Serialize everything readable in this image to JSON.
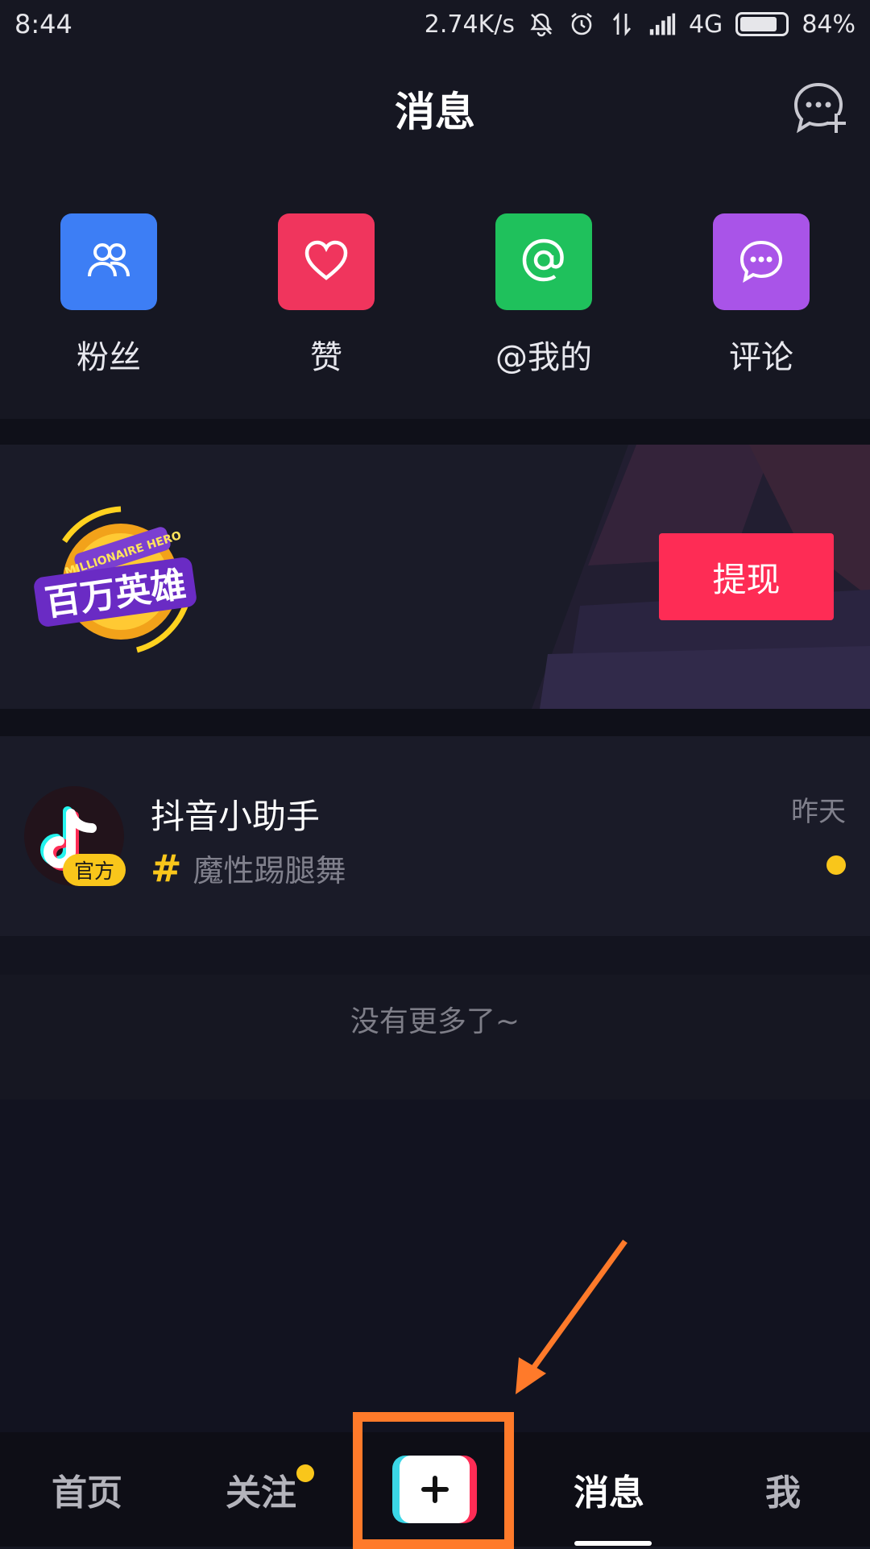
{
  "status_bar": {
    "time": "8:44",
    "network_speed": "2.74K/s",
    "network_type": "4G",
    "battery_percent": "84%",
    "battery_level": 0.84,
    "icons": [
      "mute-icon",
      "alarm-icon",
      "data-transfer-icon",
      "signal-icon",
      "battery-icon"
    ]
  },
  "header": {
    "title": "消息",
    "action_icon": "new-chat-icon"
  },
  "quick_actions": [
    {
      "label": "粉丝",
      "icon": "fans-icon",
      "color": "#3d7ef5"
    },
    {
      "label": "赞",
      "icon": "heart-icon",
      "color": "#f0355d"
    },
    {
      "label": "@我的",
      "icon": "at-icon",
      "color": "#1fc15c"
    },
    {
      "label": "评论",
      "icon": "comment-icon",
      "color": "#a954e8"
    }
  ],
  "banner": {
    "logo_icon": "millionaire-hero-logo",
    "logo_text": "百万英雄",
    "logo_subtext": "MILLIONAIRE HERO",
    "button_label": "提现",
    "button_color": "#fe2c55"
  },
  "messages": [
    {
      "name": "抖音小助手",
      "badge": "官方",
      "preview": "魔性踢腿舞",
      "time": "昨天",
      "unread": true,
      "avatar_icon": "tiktok-logo-icon"
    }
  ],
  "list_end_text": "没有更多了~",
  "tab_bar": {
    "tabs": [
      {
        "label": "首页",
        "active": false
      },
      {
        "label": "关注",
        "active": false,
        "has_dot": true
      },
      {
        "label": "消息",
        "active": true
      },
      {
        "label": "我",
        "active": false
      }
    ],
    "add_button_icon": "plus-icon"
  },
  "colors": {
    "background": "#161722",
    "accent_yellow": "#f9c61b",
    "accent_red": "#fe2c55",
    "annotation_orange": "#ff7a2a"
  }
}
